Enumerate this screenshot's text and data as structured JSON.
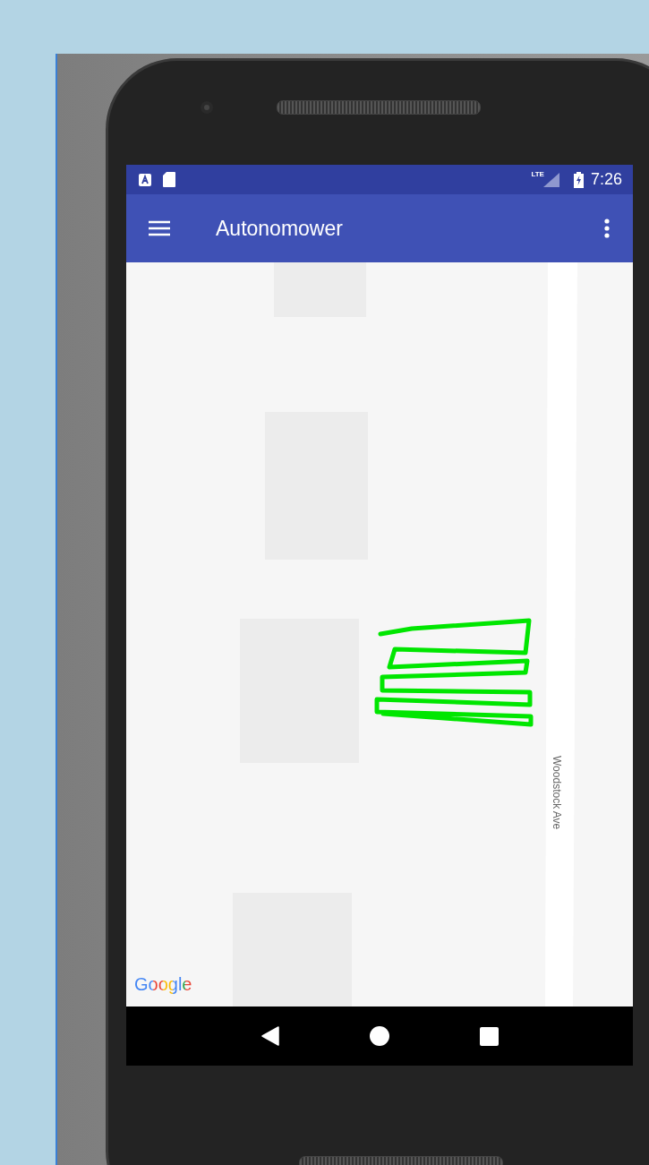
{
  "status_bar": {
    "network": "LTE",
    "time": "7:26"
  },
  "app_bar": {
    "title": "Autonomower"
  },
  "map": {
    "street_label": "Woodstock Ave",
    "attribution": "Google"
  }
}
